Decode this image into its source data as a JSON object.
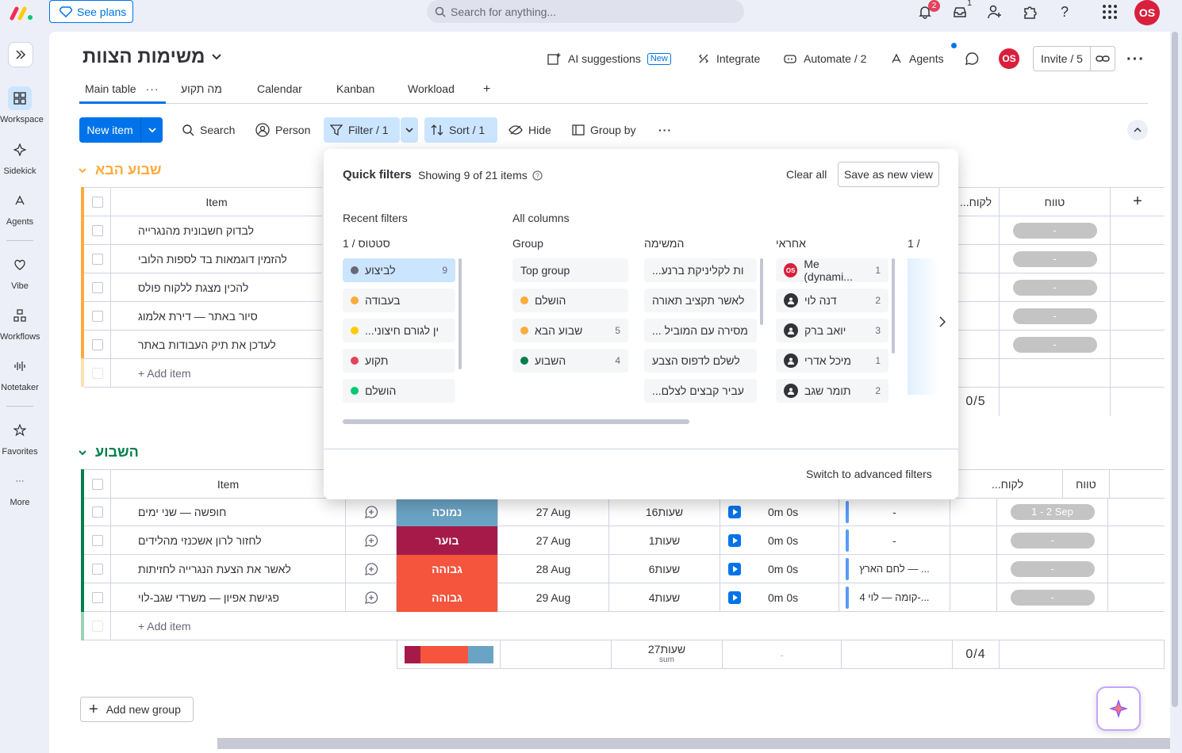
{
  "topbar": {
    "see_plans": "See plans",
    "search_placeholder": "Search for anything...",
    "notif_count": "2",
    "inbox_count": "1",
    "avatar": "OS"
  },
  "rail": {
    "workspace": "Workspace",
    "sidekick": "Sidekick",
    "agents": "Agents",
    "vibe": "Vibe",
    "workflows": "Workflows",
    "notetaker": "Notetaker",
    "favorites": "Favorites",
    "more": "More"
  },
  "board": {
    "title": "משימות הצוות",
    "ai_suggestions": "AI suggestions",
    "new_tag": "New",
    "integrate": "Integrate",
    "automate": "Automate / 2",
    "agents": "Agents",
    "avatar": "OS",
    "invite": "Invite / 5",
    "tabs": [
      "Main table",
      "מה תקוע",
      "Calendar",
      "Kanban",
      "Workload"
    ],
    "toolbar": {
      "new_item": "New item",
      "search": "Search",
      "person": "Person",
      "filter": "Filter / 1",
      "sort": "Sort / 1",
      "hide": "Hide",
      "group_by": "Group by"
    }
  },
  "groups": [
    {
      "title": "שבוע הבא",
      "color": "#fdab3d",
      "col_item": "Item",
      "col_trunc": "...לקוח",
      "col_range": "טווח",
      "count_summary": "0/5",
      "items": [
        "לבדוק חשבונית מהנגרייה",
        "להזמין דוגמאות בד לספות הלובי",
        "להכין מצגת ללקוח פולס",
        "סיור באתר — דירת אלמוג",
        "לעדכן את תיק העבודות באתר"
      ],
      "ranges": [
        "-",
        "-",
        "-",
        "-",
        "-"
      ],
      "add_item": "+ Add item"
    },
    {
      "title": "השבוע",
      "color": "#037f4c",
      "col_item": "Item",
      "col_trunc": "...לקוח",
      "col_range": "טווח",
      "count_summary": "0/4",
      "items": [
        {
          "name": "חופשה — שני ימים",
          "priority": "נמוכה",
          "pcolor": "#579bfc",
          "date": "27 Aug",
          "hours": "16שעות",
          "time": "0m 0s",
          "client": "-",
          "range": "1 - 2 Sep"
        },
        {
          "name": "לחזור לרון אשכנזי מהלידים",
          "priority": "בוער",
          "pcolor": "#a51a49",
          "date": "27 Aug",
          "hours": "1שעות",
          "time": "0m 0s",
          "client": "-",
          "range": "-"
        },
        {
          "name": "לאשר את הצעת הנגרייה לחזיתות",
          "priority": "גבוהה",
          "pcolor": "#f5543d",
          "date": "28 Aug",
          "hours": "6שעות",
          "time": "0m 0s",
          "client": "לחם הארץ — ...",
          "range": "-"
        },
        {
          "name": "פגישת אפיון — משרדי שגב-לוי",
          "priority": "גבוהה",
          "pcolor": "#f5543d",
          "date": "29 Aug",
          "hours": "4שעות",
          "time": "0m 0s",
          "client": "4 קומה — לוי-...",
          "range": "-"
        }
      ],
      "add_item": "+ Add item",
      "sum_hours": "27שעות",
      "sum_label": "sum",
      "sum_dash": "-"
    }
  ],
  "add_group": "Add new group",
  "popup": {
    "title": "Quick filters",
    "showing": "Showing 9 of 21 items",
    "clear_all": "Clear all",
    "save_view": "Save as new view",
    "recent": "Recent filters",
    "all_columns": "All columns",
    "recent_col": "1 / סטטוס",
    "recent_items": [
      {
        "label": "לביצוע",
        "count": "9",
        "color": "#676879",
        "selected": true
      },
      {
        "label": "בעבודה",
        "count": "",
        "color": "#fdab3d"
      },
      {
        "label": "...ין לגורם חיצוני",
        "count": "",
        "color": "#ffcb00"
      },
      {
        "label": "תקוע",
        "count": "",
        "color": "#e2445c"
      },
      {
        "label": "הושלם",
        "count": "",
        "color": "#00c875"
      }
    ],
    "group_col": "Group",
    "group_items": [
      {
        "label": "Top group",
        "count": "",
        "color": ""
      },
      {
        "label": "הושלם",
        "count": "",
        "color": "#fdab3d"
      },
      {
        "label": "שבוע הבא",
        "count": "5",
        "color": "#fdab3d"
      },
      {
        "label": "השבוע",
        "count": "4",
        "color": "#037f4c"
      }
    ],
    "task_col": "המשימה",
    "task_items": [
      "...ות לקליניקת ברנע",
      "לאשר תקציב תאורה",
      "... מסירה עם המוביל",
      "לשלם לדפוס הצבע",
      "...עביר קבצים לצלם"
    ],
    "owner_col": "אחראי",
    "owner_items": [
      {
        "label": "Me (dynami...",
        "count": "1"
      },
      {
        "label": "דנה לוי",
        "count": "2"
      },
      {
        "label": "יואב ברק",
        "count": "3"
      },
      {
        "label": "מיכל אדרי",
        "count": "1"
      },
      {
        "label": "תומר שגב",
        "count": "2"
      }
    ],
    "next_col": "1 /",
    "advanced": "Switch to advanced filters"
  }
}
